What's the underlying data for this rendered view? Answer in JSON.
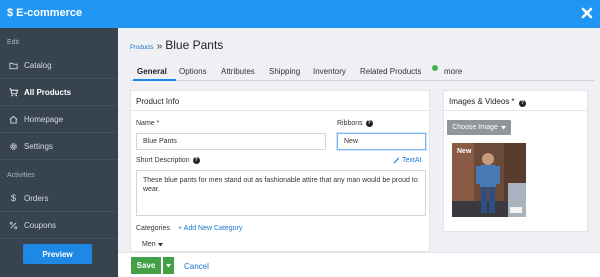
{
  "app": {
    "title": "E-commerce"
  },
  "sidebar": {
    "groups": [
      {
        "label": "Edit"
      },
      {
        "label": "Activities"
      }
    ],
    "items": [
      {
        "label": "Catalog"
      },
      {
        "label": "All Products"
      },
      {
        "label": "Homepage"
      },
      {
        "label": "Settings"
      },
      {
        "label": "Orders"
      },
      {
        "label": "Coupons"
      }
    ],
    "preview_label": "Preview"
  },
  "breadcrumb": {
    "parent": "Products",
    "separator": "»",
    "current": "Blue Pants"
  },
  "tabs": [
    {
      "label": "General"
    },
    {
      "label": "Options"
    },
    {
      "label": "Attributes"
    },
    {
      "label": "Shipping"
    },
    {
      "label": "Inventory"
    },
    {
      "label": "Related Products"
    },
    {
      "label": "more"
    }
  ],
  "product_info": {
    "heading": "Product Info",
    "name_label": "Name *",
    "name_value": "Blue Pants",
    "ribbons_label": "Ribbons",
    "ribbons_value": "New",
    "short_desc_label": "Short Description",
    "textai_label": "TextAI",
    "short_desc_value": "These blue pants for men stand out as fashionable attire that any man would be proud to wear.",
    "categories_label": "Categories",
    "add_category_label": "+ Add New Category",
    "category_chip": "Men"
  },
  "media": {
    "heading": "Images & Videos *",
    "choose_label": "Choose Image",
    "badge": "New"
  },
  "footer": {
    "save_label": "Save",
    "cancel_label": "Cancel"
  },
  "colors": {
    "topbar": "#2196f3",
    "sidebar": "#37434f",
    "accent": "#1e88e5",
    "save": "#43a047",
    "tab_dot": "#4caf50"
  }
}
